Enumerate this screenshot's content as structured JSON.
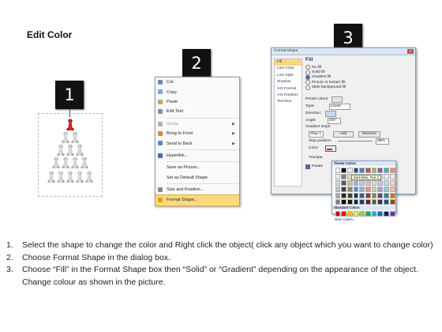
{
  "title": "Edit Color",
  "steps": [
    "1",
    "2",
    "3"
  ],
  "context_menu": {
    "items": [
      {
        "label": "Cut",
        "icon": "scissors-icon",
        "color": "#6b8bbf"
      },
      {
        "label": "Copy",
        "icon": "copy-icon",
        "color": "#8aa5d0"
      },
      {
        "label": "Paste",
        "icon": "clipboard-icon",
        "color": "#c9a45c"
      },
      {
        "label": "Edit Text",
        "icon": "edit-text-icon",
        "color": "#7c8fb0"
      },
      {
        "label": "Group",
        "icon": "group-icon",
        "color": "#b0b0b0",
        "disabled": true,
        "submenu": true
      },
      {
        "label": "Bring to Front",
        "icon": "bring-front-icon",
        "color": "#d58a3a",
        "submenu": true
      },
      {
        "label": "Send to Back",
        "icon": "send-back-icon",
        "color": "#5f86c2",
        "submenu": true
      },
      {
        "label": "Hyperlink...",
        "icon": "hyperlink-icon",
        "color": "#3c6fb8"
      },
      {
        "label": "Save as Picture...",
        "icon": "",
        "color": ""
      },
      {
        "label": "Set as Default Shape",
        "icon": "",
        "color": ""
      },
      {
        "label": "Size and Position...",
        "icon": "size-position-icon",
        "color": "#8a8a8a"
      },
      {
        "label": "Format Shape...",
        "icon": "format-shape-icon",
        "color": "#e0a020",
        "highlighted": true
      }
    ]
  },
  "dialog": {
    "title": "Format Shape",
    "categories": [
      "Fill",
      "Line Color",
      "Line Style",
      "Shadow",
      "3-D Format",
      "3-D Rotation",
      "Text Box"
    ],
    "selected_category": "Fill",
    "heading": "Fill",
    "options": [
      "No fill",
      "Solid fill",
      "Gradient fill",
      "Picture or texture fill",
      "Slide background fill"
    ],
    "selected_option": "Gradient fill",
    "preset_label": "Preset colors:",
    "type_label": "Type:",
    "type_value": "Linear",
    "direction_label": "Direction:",
    "angle_label": "Angle:",
    "angle_value": "180°",
    "gradient_stops_label": "Gradient stops",
    "stop_value": "Stop 1",
    "add_label": "Add",
    "remove_label": "Remove",
    "stop_position_label": "Stop position:",
    "stop_position_value": "96%",
    "color_label": "Color:",
    "transparency_label": "Transpa",
    "rotate_label": "Rotate"
  },
  "color_dropdown": {
    "theme_header": "Theme Colors",
    "tooltip": "Dark Blue, Text 2",
    "standard_header": "Standard Colors",
    "more": "More Colors...",
    "theme_top": [
      "#ffffff",
      "#000000",
      "#eeece1",
      "#1f497d",
      "#4f81bd",
      "#c0504d",
      "#9bbb59",
      "#8064a2",
      "#4bacc6",
      "#f79646"
    ],
    "theme_shades": [
      [
        "#f2f2f2",
        "#7f7f7f",
        "#ddd9c3",
        "#c6d9f0",
        "#dbe5f1",
        "#f2dcdb",
        "#ebf1dd",
        "#e5e0ec",
        "#dbeef3",
        "#fdeada"
      ],
      [
        "#d8d8d8",
        "#595959",
        "#c4bd97",
        "#8db3e2",
        "#b8cce4",
        "#e5b9b7",
        "#d7e3bc",
        "#ccc1d9",
        "#b7dde8",
        "#fbd5b5"
      ],
      [
        "#bfbfbf",
        "#3f3f3f",
        "#938953",
        "#548dd4",
        "#95b3d7",
        "#d99694",
        "#c3d69b",
        "#b2a2c7",
        "#92cddc",
        "#fac08f"
      ],
      [
        "#a5a5a5",
        "#262626",
        "#494429",
        "#17365d",
        "#366092",
        "#953734",
        "#76923c",
        "#5f497a",
        "#31859b",
        "#e36c09"
      ],
      [
        "#7f7f7f",
        "#0c0c0c",
        "#1d1b10",
        "#0f243e",
        "#244061",
        "#632423",
        "#4f6128",
        "#3f3151",
        "#205867",
        "#974806"
      ]
    ],
    "standard": [
      "#c00000",
      "#ff0000",
      "#ffc000",
      "#ffff00",
      "#92d050",
      "#00b050",
      "#00b0f0",
      "#0070c0",
      "#002060",
      "#7030a0"
    ]
  },
  "instructions": [
    {
      "num": "1.",
      "text": "Select the shape to change the color and Right click the object( click any object which you want to change color)"
    },
    {
      "num": "2.",
      "text": "Choose Format Shape in the dialog box."
    },
    {
      "num": "3.",
      "text": "Choose “Fill” in the Format Shape box then “Solid” or “Gradient” depending on the appearance of the object. Change colour as shown in the picture."
    }
  ]
}
